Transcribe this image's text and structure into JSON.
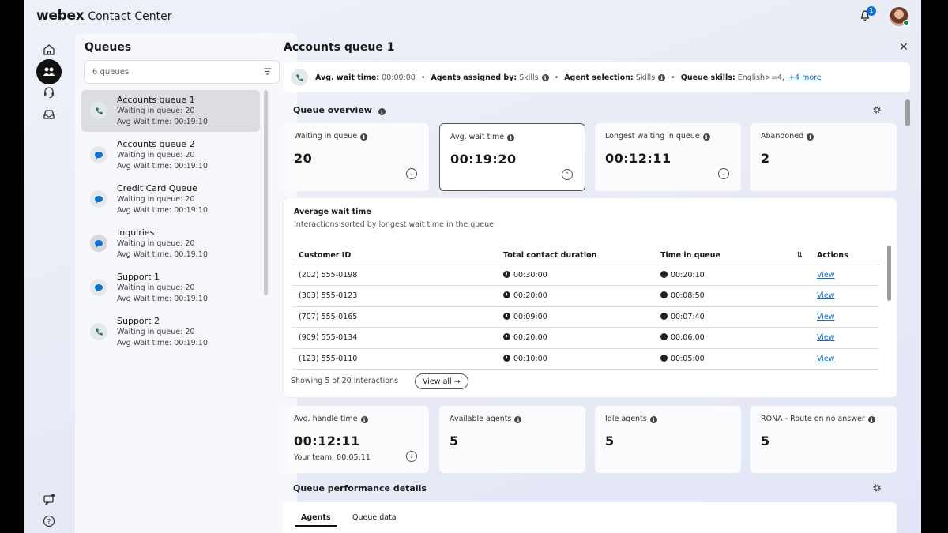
{
  "app": {
    "brand": "webex",
    "product": "Contact Center",
    "notification_count": "1"
  },
  "queues_panel": {
    "title": "Queues",
    "search_text": "6 queues",
    "items": [
      {
        "name": "Accounts queue 1",
        "waiting": "Waiting in queue: 20",
        "avg": "Avg Wait time: 00:19:10",
        "icon": "phone-icon",
        "selected": true
      },
      {
        "name": "Accounts queue 2",
        "waiting": "Waiting in queue: 20",
        "avg": "Avg Wait time: 00:19:10",
        "icon": "chat-icon"
      },
      {
        "name": "Credit Card Queue",
        "waiting": "Waiting in queue: 20",
        "avg": "Avg Wait time: 00:19:10",
        "icon": "chat-icon"
      },
      {
        "name": "Inquiries",
        "waiting": "Waiting in queue: 20",
        "avg": "Avg Wait time: 00:19:10",
        "icon": "chat-icon"
      },
      {
        "name": "Support 1",
        "waiting": "Waiting in queue: 20",
        "avg": "Avg Wait time: 00:19:10",
        "icon": "chat-icon"
      },
      {
        "name": "Support 2",
        "waiting": "Waiting in queue: 20",
        "avg": "Avg Wait time: 00:19:10",
        "icon": "phone-icon"
      }
    ]
  },
  "detail": {
    "title": "Accounts queue 1",
    "info": {
      "wait_label": "Avg. wait time:",
      "wait_value": "00:00:00",
      "assigned_label": "Agents assigned by:",
      "assigned_value": "Skills",
      "selection_label": "Agent selection:",
      "selection_value": "Skills",
      "skills_label": "Queue skills:",
      "skills_value": "English>=4,",
      "skills_more": "+4 more"
    },
    "overview_title": "Queue overview",
    "cards": [
      {
        "label": "Waiting in queue",
        "value": "20"
      },
      {
        "label": "Avg. wait time",
        "value": "00:19:20"
      },
      {
        "label": "Longest waiting in queue",
        "value": "00:12:11"
      },
      {
        "label": "Abandoned",
        "value": "2"
      }
    ],
    "table": {
      "title": "Average wait time",
      "subtitle": "Interactions sorted by longest wait time in the queue",
      "headers": [
        "Customer ID",
        "Total contact duration",
        "Time in queue",
        "Actions"
      ],
      "rows": [
        {
          "id": "(202) 555-0198",
          "duration": "00:30:00",
          "time": "00:20:10",
          "action": "View"
        },
        {
          "id": "(303) 555-0123",
          "duration": "00:20:00",
          "time": "00:08:50",
          "action": "View"
        },
        {
          "id": "(707) 555-0165",
          "duration": "00:09:00",
          "time": "00:07:40",
          "action": "View"
        },
        {
          "id": "(909) 555-0134",
          "duration": "00:20:00",
          "time": "00:06:00",
          "action": "View"
        },
        {
          "id": "(123) 555-0110",
          "duration": "00:10:00",
          "time": "00:05:00",
          "action": "View"
        }
      ],
      "footer": "Showing 5 of 20 interactions",
      "view_all": "View all →"
    },
    "agent_cards": [
      {
        "label": "Avg. handle time",
        "value": "00:12:11",
        "sub": "Your team: 00:05:11"
      },
      {
        "label": "Available agents",
        "value": "5"
      },
      {
        "label": "Idle agents",
        "value": "5"
      },
      {
        "label": "RONA - Route on no answer",
        "value": "5"
      }
    ],
    "performance_title": "Queue performance details",
    "tabs": [
      "Agents",
      "Queue data"
    ]
  }
}
